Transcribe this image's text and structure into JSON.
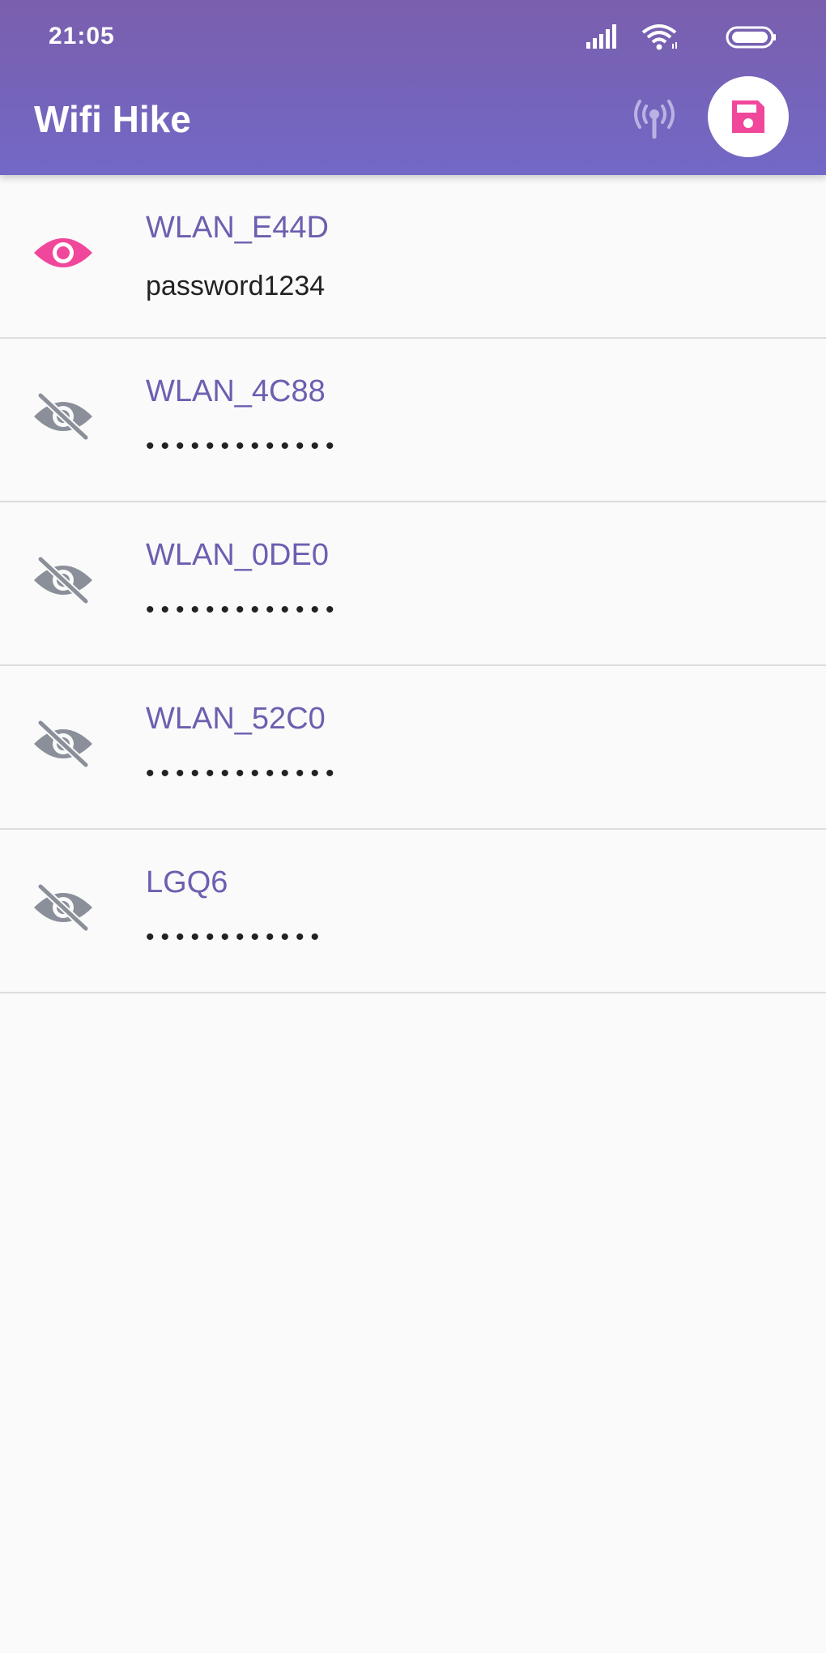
{
  "status_bar": {
    "time": "21:05",
    "icons": [
      "signal-icon",
      "wifi-icon",
      "battery-icon"
    ]
  },
  "app_bar": {
    "title": "Wifi Hike",
    "actions": [
      "antenna-icon",
      "save-icon"
    ]
  },
  "colors": {
    "appbar_top": "#7a5fad",
    "appbar_bottom": "#7268c6",
    "accent_pink": "#f0479b",
    "ssid_purple": "#6c5fb0",
    "icon_gray": "#8a8f99"
  },
  "networks": [
    {
      "ssid": "WLAN_E44D",
      "password": "password1234",
      "visible": true
    },
    {
      "ssid": "WLAN_4C88",
      "password": "•••••••••••••",
      "visible": false
    },
    {
      "ssid": "WLAN_0DE0",
      "password": "•••••••••••••",
      "visible": false
    },
    {
      "ssid": "WLAN_52C0",
      "password": "•••••••••••••",
      "visible": false
    },
    {
      "ssid": "LGQ6",
      "password": "••••••••••••",
      "visible": false
    }
  ]
}
